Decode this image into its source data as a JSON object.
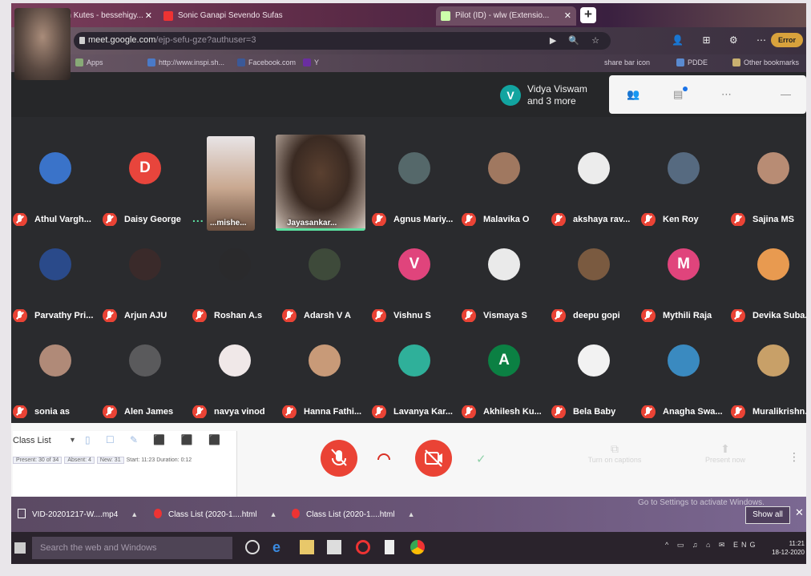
{
  "browser": {
    "tabs": [
      {
        "label": "Photo from Kutes - bessehigy..."
      },
      {
        "label": "Sonic Ganapi Sevendo Sufas"
      },
      {
        "label": "Pilot (ID) - wlw (Extensio..."
      }
    ],
    "url_host": "meet.google.com",
    "url_path": "/ejp-sefu-gze?authuser=3",
    "error_label": "Error",
    "bookmarks": [
      "Apps",
      "http://www.inspi.sh...",
      "Facebook.com",
      "Y"
    ],
    "bookmark_right": [
      "share bar icon",
      "PDDE",
      "Other bookmarks"
    ]
  },
  "meet": {
    "presence_initial": "V",
    "presence_name": "Vidya Viswam",
    "presence_more": "and 3 more",
    "participants": [
      {
        "name": "Athul Vargh...",
        "initial": "",
        "color": "#3a73c9"
      },
      {
        "name": "Daisy George",
        "initial": "D",
        "color": "#e8453c"
      },
      {
        "name": "Agnus Mariy...",
        "initial": "",
        "color": "#55686a"
      },
      {
        "name": "Malavika O",
        "initial": "",
        "color": "#a07860"
      },
      {
        "name": "akshaya rav...",
        "initial": "",
        "color": "#ececec"
      },
      {
        "name": "Ken Roy",
        "initial": "",
        "color": "#566a80"
      },
      {
        "name": "Sajina MS",
        "initial": "",
        "color": "#b88c74"
      },
      {
        "name": "Parvathy Pri...",
        "initial": "",
        "color": "#2a4a8a"
      },
      {
        "name": "Arjun AJU",
        "initial": "",
        "color": "#3a2a2a"
      },
      {
        "name": "Roshan A.s",
        "initial": "",
        "color": "#2a2a2c"
      },
      {
        "name": "Adarsh V A",
        "initial": "",
        "color": "#3e4a3a"
      },
      {
        "name": "Vishnu S",
        "initial": "V",
        "color": "#e0447c"
      },
      {
        "name": "Vismaya S",
        "initial": "",
        "color": "#eaeaea"
      },
      {
        "name": "deepu gopi",
        "initial": "",
        "color": "#7a5a40"
      },
      {
        "name": "Mythili Raja",
        "initial": "M",
        "color": "#e0447c"
      },
      {
        "name": "Devika Suba...",
        "initial": "",
        "color": "#e89a50"
      },
      {
        "name": "sonia as",
        "initial": "",
        "color": "#b08a78"
      },
      {
        "name": "Alen James",
        "initial": "",
        "color": "#5a5a5c"
      },
      {
        "name": "navya vinod",
        "initial": "",
        "color": "#f0e8e8"
      },
      {
        "name": "Hanna Fathi...",
        "initial": "",
        "color": "#c89a78"
      },
      {
        "name": "Lavanya Kar...",
        "initial": "",
        "color": "#2fb09a"
      },
      {
        "name": "Akhilesh Ku...",
        "initial": "A",
        "color": "#0b8043"
      },
      {
        "name": "Bela Baby",
        "initial": "",
        "color": "#f2f2f2"
      },
      {
        "name": "Anagha Swa...",
        "initial": "",
        "color": "#3a8ac0"
      },
      {
        "name": "Muralikrishn...",
        "initial": "",
        "color": "#c8a068"
      }
    ],
    "video_1_name": "...mishe...",
    "video_2_name": "Jayasankar...",
    "muted_marker": "..."
  },
  "classlist": {
    "title": "Class List",
    "chips": [
      "Present: 30 of 34",
      "Absent: 4",
      "New: 31",
      "Start: 11:23",
      "Duration: 0:12"
    ]
  },
  "controls": {
    "ghost_left": "Turn on captions",
    "ghost_right": "Present now"
  },
  "downloads": {
    "items": [
      "VID-20201217-W....mp4",
      "Class List (2020-1....html",
      "Class List (2020-1....html"
    ],
    "activate_text": "Go to Settings to activate Windows.",
    "show_all": "Show all"
  },
  "taskbar": {
    "search_placeholder": "Search the web and Windows",
    "lang": "ENG",
    "time": "11:21",
    "date": "18-12-2020"
  }
}
